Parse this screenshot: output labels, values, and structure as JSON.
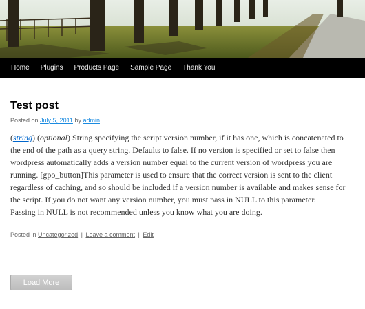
{
  "nav": {
    "items": [
      {
        "label": "Home"
      },
      {
        "label": "Plugins"
      },
      {
        "label": "Products Page"
      },
      {
        "label": "Sample Page"
      },
      {
        "label": "Thank You"
      }
    ]
  },
  "post": {
    "title": "Test post",
    "meta": {
      "posted_on": "Posted on",
      "date": "July 5, 2011",
      "by": "by",
      "author": "admin"
    },
    "content": {
      "string_link": "string",
      "open_paren": "(",
      "close_paren": ") (",
      "optional": "optional",
      "paragraph1_rest": ") String specifying the script version number, if it has one, which is concatenated to the end of the path as a query string. Defaults to false. If no version is specified or set to false then wordpress automatically adds a version number equal to the current version of wordpress you are running. [gpo_button]This parameter is used to ensure that the correct version is sent to the client regardless of caching, and so should be included if a version number is available and makes sense for the script. If you do not want any version number, you must pass in NULL to this parameter.",
      "paragraph2": "Passing in NULL is not recommended unless you know what you are doing."
    },
    "utility": {
      "posted_in": "Posted in",
      "category": "Uncategorized",
      "sep": "|",
      "comment": "Leave a comment",
      "edit": "Edit"
    }
  },
  "load_more": "Load More"
}
